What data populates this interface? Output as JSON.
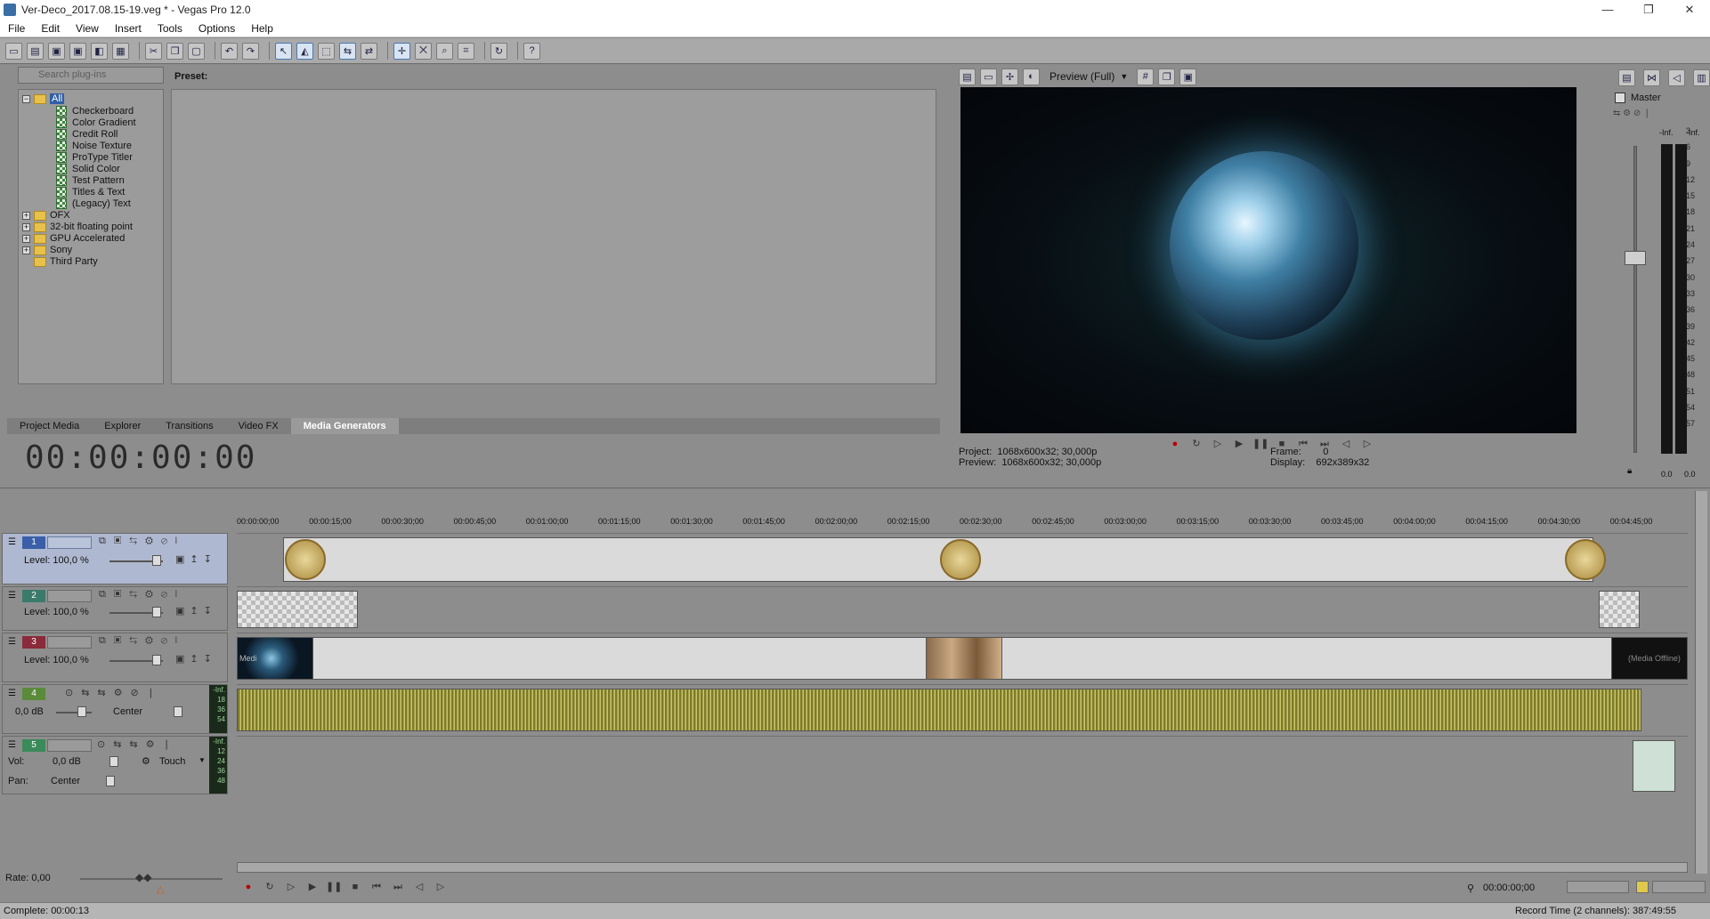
{
  "window": {
    "title": "Ver-Deco_2017.08.15-19.veg * - Vegas Pro 12.0",
    "minimize": "—",
    "maximize": "❐",
    "close": "✕"
  },
  "menu": [
    "File",
    "Edit",
    "View",
    "Insert",
    "Tools",
    "Options",
    "Help"
  ],
  "plugins": {
    "search_placeholder": "Search plug-ins",
    "tree": {
      "root": "All",
      "children": [
        "Checkerboard",
        "Color Gradient",
        "Credit Roll",
        "Noise Texture",
        "ProType Titler",
        "Solid Color",
        "Test Pattern",
        "Titles & Text",
        "(Legacy) Text"
      ],
      "folders": [
        "OFX",
        "32-bit floating point",
        "GPU Accelerated",
        "Sony",
        "Third Party"
      ]
    },
    "preset_label": "Preset:"
  },
  "tabs": [
    "Project Media",
    "Explorer",
    "Transitions",
    "Video FX",
    "Media Generators"
  ],
  "active_tab": "Media Generators",
  "timecode": "00:00:00:00",
  "preview": {
    "mode": "Preview (Full)",
    "project_label": "Project:",
    "project_value": "1068x600x32; 30,000p",
    "preview_label": "Preview:",
    "preview_value": "1068x600x32; 30,000p",
    "frame_label": "Frame:",
    "frame_value": "0",
    "display_label": "Display:",
    "display_value": "692x389x32"
  },
  "mixer": {
    "label": "Master",
    "peak_left": "-Inf.",
    "peak_right": "-Inf.",
    "scale": [
      "3",
      "6",
      "9",
      "12",
      "15",
      "18",
      "21",
      "24",
      "27",
      "30",
      "33",
      "36",
      "39",
      "42",
      "45",
      "48",
      "51",
      "54",
      "57"
    ],
    "bottom_left": "0.0",
    "bottom_right": "0.0"
  },
  "ruler": [
    "00:00:00;00",
    "00:00:15;00",
    "00:00:30;00",
    "00:00:45;00",
    "00:01:00;00",
    "00:01:15;00",
    "00:01:30;00",
    "00:01:45;00",
    "00:02:00;00",
    "00:02:15;00",
    "00:02:30;00",
    "00:02:45;00",
    "00:03:00;00",
    "00:03:15;00",
    "00:03:30;00",
    "00:03:45;00",
    "00:04:00;00",
    "00:04:15;00",
    "00:04:30;00",
    "00:04:45;00"
  ],
  "tracks": [
    {
      "num": "1",
      "type": "video",
      "level": "Level: 100,0 %"
    },
    {
      "num": "2",
      "type": "video",
      "level": "Level: 100,0 %"
    },
    {
      "num": "3",
      "type": "video",
      "level": "Level: 100,0 %"
    },
    {
      "num": "4",
      "type": "audio",
      "vol": "0,0 dB",
      "pan": "Center",
      "meter_top": "-Inf.",
      "meter_vals": [
        "18",
        "36",
        "54"
      ]
    },
    {
      "num": "5",
      "type": "audio",
      "vol_label": "Vol:",
      "vol": "0,0 dB",
      "pan_label": "Pan:",
      "pan": "Center",
      "mode": "Touch",
      "meter_top": "-Inf.",
      "meter_vals": [
        "12",
        "24",
        "36",
        "48"
      ]
    }
  ],
  "clip_text": {
    "media_offline": "(Media Offline)",
    "media_left": "Medi"
  },
  "rate": "Rate: 0,00",
  "cursor_time": "00:00:00;00",
  "status": {
    "left": "Complete: 00:00:13",
    "right": "Record Time (2 channels): 387:49:55"
  },
  "colors": {
    "accent": "#4a78b4",
    "audio_wave": "#9c9843",
    "track1": "#3a5fa8",
    "track2": "#3a7a6a",
    "track3": "#8a2a3a",
    "track4": "#5a8a3a",
    "track5": "#3a8a5a"
  }
}
